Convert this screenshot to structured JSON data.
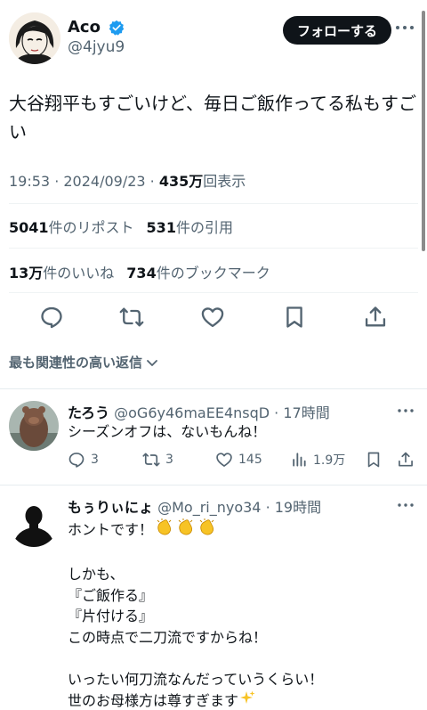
{
  "author": {
    "name": "Aco",
    "handle": "@4jyu9",
    "follow_label": "フォローする",
    "verified_color": "#1d9bf0"
  },
  "tweet": {
    "text": "大谷翔平もすごいけど、毎日ご飯作ってる私もすごい",
    "time": "19:53 · 2024/09/23 · ",
    "views_value": "435万",
    "views_label": "回表示"
  },
  "stats": {
    "reposts_value": "5041",
    "reposts_label": "件のリポスト",
    "quotes_value": "531",
    "quotes_label": "件の引用",
    "likes_value": "13万",
    "likes_label": "件のいいね",
    "bookmarks_value": "734",
    "bookmarks_label": "件のブックマーク"
  },
  "actions": [
    "reply-icon",
    "repost-icon",
    "like-icon",
    "bookmark-icon",
    "share-icon"
  ],
  "sort": {
    "label": "最も関連性の高い返信"
  },
  "replies": [
    {
      "name": "たろう",
      "handle": "@oG6y46maEE4nsqD",
      "time": " · 17時間",
      "text": "シーズンオフは、ないもんね！",
      "reply_count": "3",
      "repost_count": "3",
      "like_count": "145",
      "view_count": "1.9万"
    },
    {
      "name": "もぅりぃにょ",
      "handle": "@Mo_ri_nyo34",
      "time": " · 19時間",
      "lines": [
        "ホントです！",
        "",
        "しかも、",
        "『ご飯作る』",
        "『片付ける』",
        "この時点で二刀流ですからね！",
        "",
        "いったい何刀流なんだっていうくらい！",
        "世のお母様方は尊すぎます"
      ]
    }
  ],
  "colors": {
    "text": "#0f1419",
    "secondary": "#536471",
    "accent": "#1d9bf0"
  }
}
